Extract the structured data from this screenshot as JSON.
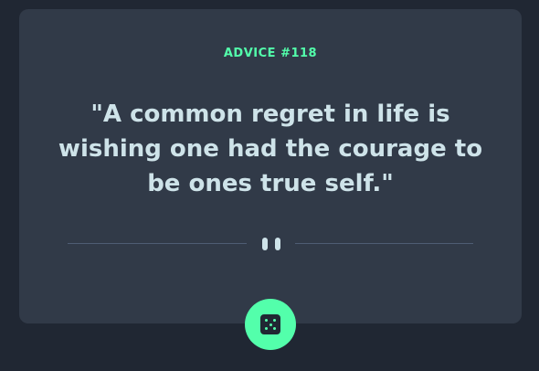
{
  "card": {
    "advice_id": "ADVICE #118",
    "quote": "\"A common regret in life is wishing one had the courage to be ones true self.\""
  },
  "icons": {
    "divider": "pause-icon",
    "button": "dice-icon"
  },
  "colors": {
    "background": "#202733",
    "card": "#313a48",
    "accent": "#53ffab",
    "text": "#cee3e9",
    "divider": "#4f5d74"
  }
}
